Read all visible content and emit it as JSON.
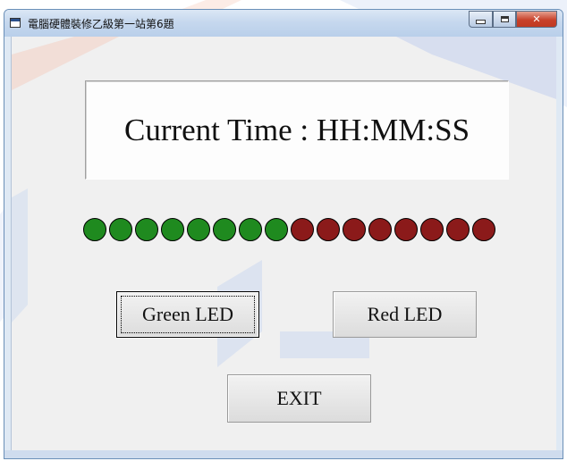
{
  "window": {
    "title": "電腦硬體裝修乙級第一站第6題",
    "icons": {
      "app": "app-window-icon",
      "minimize": "minimize-icon",
      "maximize": "maximize-icon",
      "close": "close-x-icon"
    },
    "close_glyph": "✕"
  },
  "display": {
    "time_text": "Current Time : HH:MM:SS"
  },
  "leds": [
    {
      "state": "green"
    },
    {
      "state": "green"
    },
    {
      "state": "green"
    },
    {
      "state": "green"
    },
    {
      "state": "green"
    },
    {
      "state": "green"
    },
    {
      "state": "green"
    },
    {
      "state": "green"
    },
    {
      "state": "red"
    },
    {
      "state": "red"
    },
    {
      "state": "red"
    },
    {
      "state": "red"
    },
    {
      "state": "red"
    },
    {
      "state": "red"
    },
    {
      "state": "red"
    },
    {
      "state": "red"
    }
  ],
  "colors": {
    "led_green": "#1f8a1f",
    "led_red": "#8b1a1a"
  },
  "buttons": {
    "green_led": "Green LED",
    "red_led": "Red LED",
    "exit": "EXIT"
  }
}
